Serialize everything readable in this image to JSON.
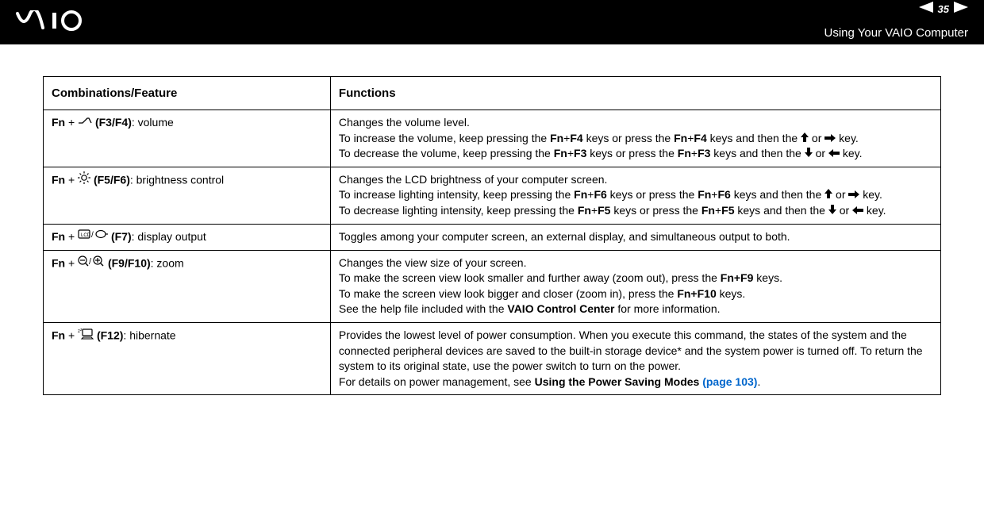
{
  "header": {
    "logo_alt": "VAIO",
    "page_number": "35",
    "section_title": "Using Your VAIO Computer"
  },
  "table": {
    "headers": {
      "col1": "Combinations/Feature",
      "col2": "Functions"
    },
    "rows": [
      {
        "combo_prefix": "Fn",
        "combo_keys": " (F3/F4)",
        "combo_label": ": volume",
        "fn_lines": [
          "Changes the volume level.",
          "To increase the volume, keep pressing the |Fn|+|F4| keys or press the |Fn|+|F4| keys and then the [up] or [right] key.",
          "To decrease the volume, keep pressing the |Fn|+|F3| keys or press the |Fn|+|F3| keys and then the [down] or [left] key."
        ]
      },
      {
        "combo_prefix": "Fn",
        "combo_keys": " (F5/F6)",
        "combo_label": ": brightness control",
        "fn_lines": [
          "Changes the LCD brightness of your computer screen.",
          "To increase lighting intensity, keep pressing the |Fn|+|F6| keys or press the |Fn|+|F6| keys and then the [up] or [right] key.",
          "To decrease lighting intensity, keep pressing the |Fn|+|F5| keys or press the |Fn|+|F5| keys and then the [down] or [left] key."
        ]
      },
      {
        "combo_prefix": "Fn",
        "combo_keys": " (F7)",
        "combo_label": ": display output",
        "fn_lines": [
          "Toggles among your computer screen, an external display, and simultaneous output to both."
        ]
      },
      {
        "combo_prefix": "Fn",
        "combo_keys": " (F9/F10)",
        "combo_label": ": zoom",
        "fn_lines": [
          "Changes the view size of your screen.",
          "To make the screen view look smaller and further away (zoom out), press the |Fn+F9| keys.",
          "To make the screen view look bigger and closer (zoom in), press the |Fn+F10| keys.",
          "See the help file included with the |VAIO Control Center| for more information."
        ]
      },
      {
        "combo_prefix": "Fn",
        "combo_keys": " (F12)",
        "combo_label": ": hibernate",
        "fn_lines": [
          "Provides the lowest level of power consumption. When you execute this command, the states of the system and the connected peripheral devices are saved to the built-in storage device* and the system power is turned off. To return the system to its original state, use the power switch to turn on the power.",
          "For details on power management, see |Using the Power Saving Modes| [[(page 103)]]."
        ]
      }
    ]
  },
  "icons": {
    "row0": "volume",
    "row1": "brightness",
    "row2": "display",
    "row3": "zoom",
    "row4": "hibernate"
  }
}
